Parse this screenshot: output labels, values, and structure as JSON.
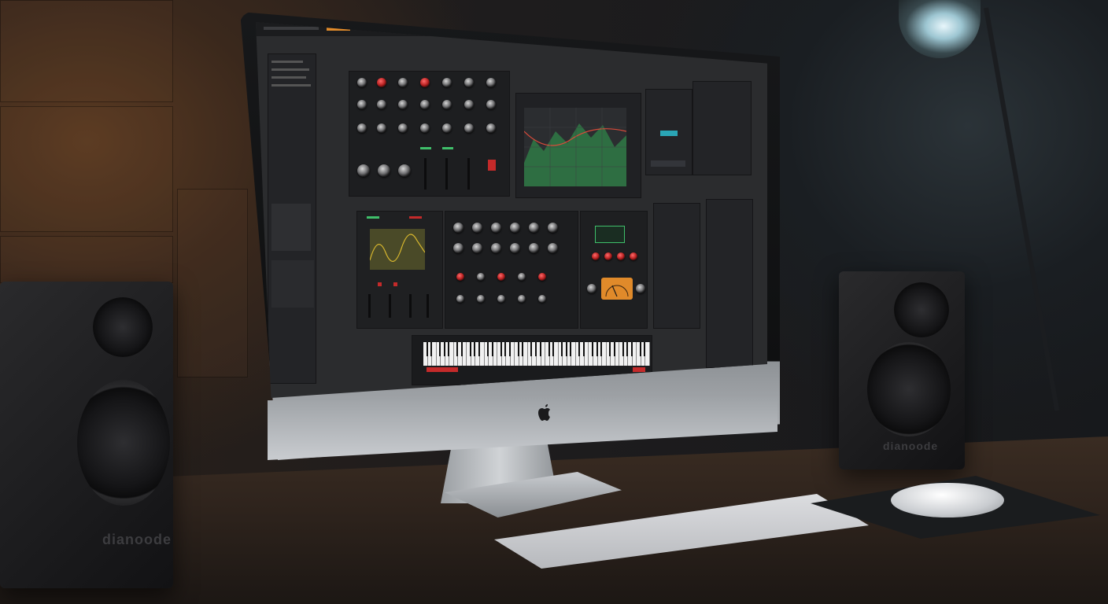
{
  "scene": {
    "speaker_brand_left": "dianoode",
    "speaker_brand_right": "dianoode"
  },
  "colors": {
    "accent_red": "#c42a2a",
    "accent_green": "#3fbf6a",
    "accent_orange": "#e08a2a",
    "eq_green": "#2f7a45",
    "eq_line": "#d94a3a",
    "scope_line": "#d6b62e"
  },
  "icons": {
    "apple_logo": "apple-icon"
  }
}
